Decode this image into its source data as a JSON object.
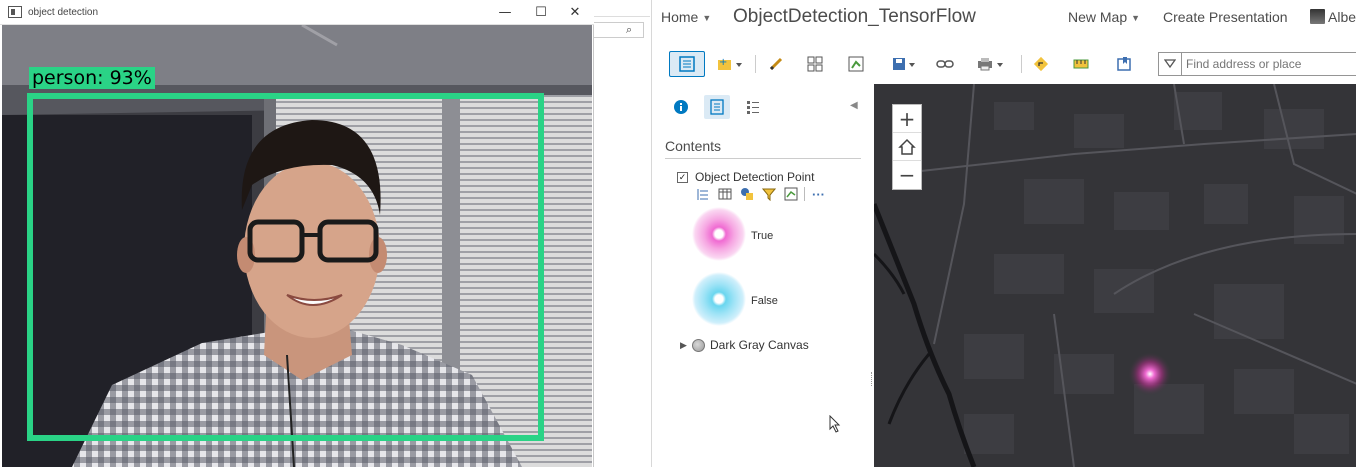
{
  "detection_window": {
    "title": "object detection",
    "minimize": "—",
    "maximize": "☐",
    "close": "✕",
    "detection_label": "person: 93%",
    "box_color": "#2ad386"
  },
  "middle_window": {
    "search_icon": "⌕"
  },
  "map_viewer": {
    "header": {
      "home_label": "Home",
      "map_title": "ObjectDetection_TensorFlow",
      "new_map_label": "New Map",
      "create_presentation_label": "Create Presentation",
      "user_name": "Albe"
    },
    "search": {
      "placeholder": "Find address or place"
    },
    "panel": {
      "contents_title": "Contents",
      "layer_name": "Object Detection Point",
      "layer_checked": "✓",
      "legend": [
        {
          "label": "True",
          "color": "#f06ad2"
        },
        {
          "label": "False",
          "color": "#6ad6ef"
        }
      ],
      "basemap_name": "Dark Gray Canvas",
      "more_icon": "···"
    },
    "map": {
      "zoom_in": "+",
      "zoom_out": "−",
      "background": "#343438",
      "point_color": "#f06ad2"
    },
    "accent": "#0079c1"
  }
}
